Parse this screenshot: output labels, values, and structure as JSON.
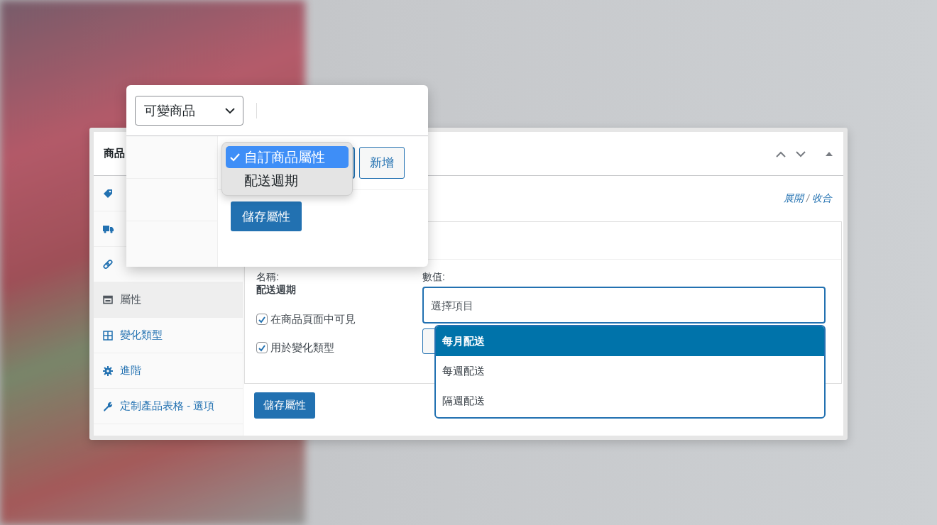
{
  "product_panel": {
    "title": "商品",
    "tabs": [
      {
        "kind": "tag",
        "selected": false
      },
      {
        "kind": "truck",
        "selected": false
      },
      {
        "kind": "link",
        "selected": false
      },
      {
        "kind": "attributes",
        "label": "屬性",
        "selected": true
      },
      {
        "kind": "grid",
        "label": "變化類型",
        "selected": false
      },
      {
        "kind": "gear",
        "label": "進階",
        "selected": false
      },
      {
        "kind": "wrench",
        "label": "定制產品表格 - 選項",
        "selected": false
      }
    ],
    "expand_link": "展開",
    "separator": "/",
    "collapse_link": "收合",
    "attribute": {
      "name_label": "名稱:",
      "name": "配送週期",
      "options": [
        {
          "label": "在商品頁面中可見",
          "checked": true
        },
        {
          "label": "用於變化類型",
          "checked": true
        }
      ],
      "values_label": "數值:",
      "values_placeholder": "選擇項目"
    },
    "save_button": "儲存屬性"
  },
  "type_card": {
    "product_type": "可變商品",
    "attribute_menu": [
      {
        "label": "自訂商品屬性",
        "selected": true
      },
      {
        "label": "配送週期",
        "selected": false
      }
    ],
    "add_button": "新增",
    "save_button": "儲存屬性"
  },
  "values_dropdown": [
    {
      "label": "每月配送",
      "selected": true
    },
    {
      "label": "每週配送",
      "selected": false
    },
    {
      "label": "隔週配送",
      "selected": false
    }
  ]
}
